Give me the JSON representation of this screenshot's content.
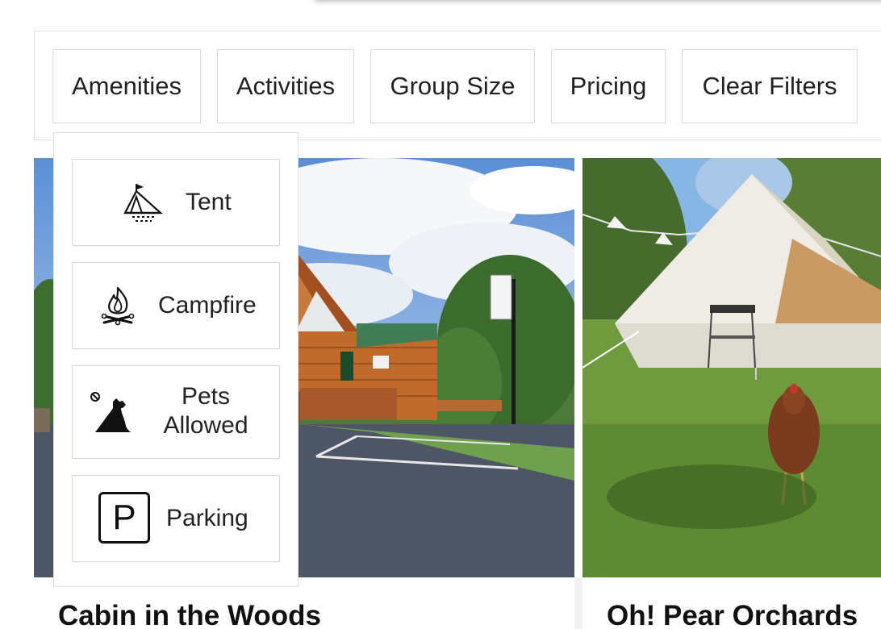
{
  "filters": {
    "amenities_label": "Amenities",
    "activities_label": "Activities",
    "group_size_label": "Group Size",
    "pricing_label": "Pricing",
    "clear_label": "Clear Filters"
  },
  "amenities_dropdown": {
    "items": [
      {
        "label": "Tent",
        "icon": "tent-icon"
      },
      {
        "label": "Campfire",
        "icon": "campfire-icon"
      },
      {
        "label_line1": "Pets",
        "label_line2": "Allowed",
        "icon": "pet-icon"
      },
      {
        "label": "Parking",
        "icon": "parking-icon",
        "icon_text": "P"
      }
    ]
  },
  "listings": [
    {
      "title": "Cabin in the Woods",
      "image": "log-cabin-photo"
    },
    {
      "title": "Oh! Pear Orchards",
      "image": "bell-tent-photo"
    }
  ],
  "colors": {
    "border": "#dcdcdc",
    "text": "#222222",
    "background": "#ffffff"
  }
}
